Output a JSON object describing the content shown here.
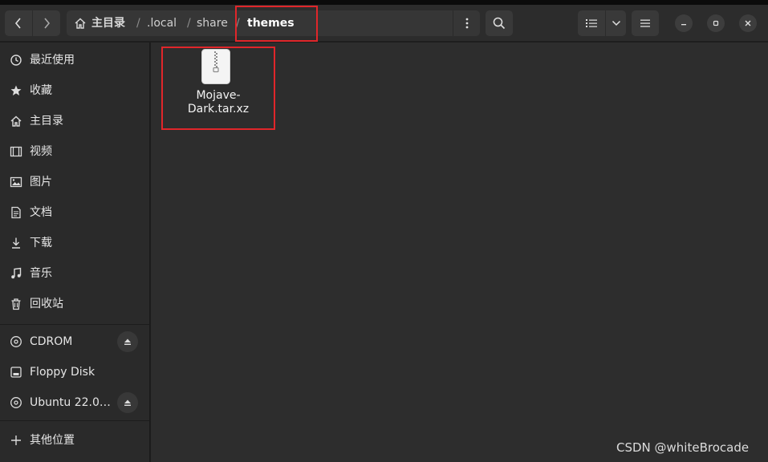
{
  "header": {
    "breadcrumb": [
      "主目录",
      ".local",
      "share",
      "themes"
    ],
    "separator": "/"
  },
  "sidebar": {
    "places": [
      {
        "label": "最近使用",
        "icon": "recent-icon"
      },
      {
        "label": "收藏",
        "icon": "star-icon"
      },
      {
        "label": "主目录",
        "icon": "home-icon"
      },
      {
        "label": "视频",
        "icon": "video-icon"
      },
      {
        "label": "图片",
        "icon": "picture-icon"
      },
      {
        "label": "文档",
        "icon": "document-icon"
      },
      {
        "label": "下载",
        "icon": "download-icon"
      },
      {
        "label": "音乐",
        "icon": "music-icon"
      },
      {
        "label": "回收站",
        "icon": "trash-icon"
      }
    ],
    "devices": [
      {
        "label": "CDROM",
        "icon": "disc-icon",
        "ejectable": true
      },
      {
        "label": "Floppy Disk",
        "icon": "drive-icon",
        "ejectable": false
      },
      {
        "label": "Ubuntu 22.0…",
        "icon": "disc-icon",
        "ejectable": true
      }
    ],
    "other": {
      "label": "其他位置",
      "icon": "plus-icon"
    }
  },
  "files": [
    {
      "name": "Mojave-Dark.tar.xz",
      "name_lines": [
        "Mojave-",
        "Dark.tar.xz"
      ],
      "icon": "archive-icon"
    }
  ],
  "watermark": "CSDN @whiteBrocade",
  "colors": {
    "highlight": "#e0262a",
    "sidebar": "#2a2a2a",
    "main": "#2d2d2d",
    "header": "#2c2c2c"
  }
}
